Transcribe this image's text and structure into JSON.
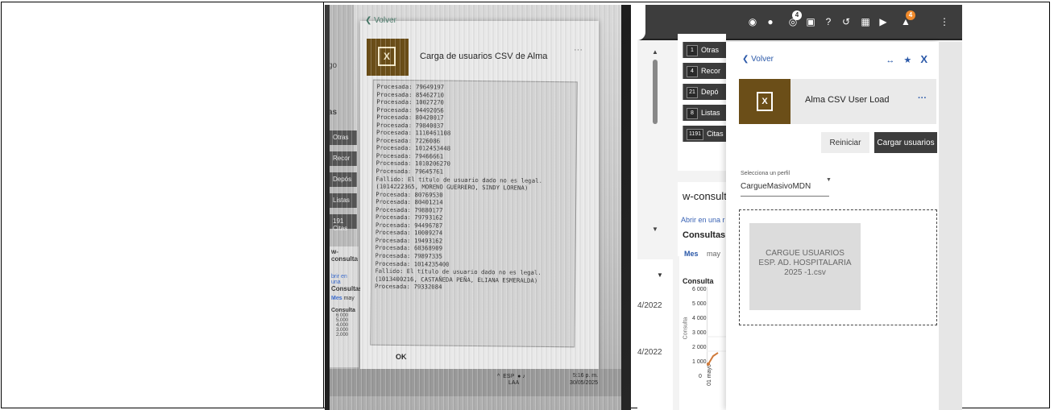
{
  "photo": {
    "back_label": "Volver",
    "dialog_title": "Carga de usuarios CSV de Alma",
    "dialog_menu": "···",
    "tile_glyph": "X",
    "left_fragment_1": "go",
    "left_fragment_2": "as",
    "left_chips": [
      "Otras",
      "Recor",
      "Depós",
      "Listas",
      "191 Citas"
    ],
    "log_lines": [
      "Procesada: 79649197",
      "Procesada: 85462710",
      "Procesada: 10027270",
      "Procesada: 94492056",
      "Procesada: 80420017",
      "Procesada: 79840037",
      "Procesada: 1110461108",
      "Procesada: 7226086",
      "Procesada: 1012453448",
      "Procesada: 79466661",
      "Procesada: 1010206270",
      "Procesada: 79645761",
      "Fallido: El título de usuario dado no es legal. (1014222365, MORENO GUERRERO, SINDY LORENA)",
      "Procesada: 80769530",
      "Procesada: 80401214",
      "Procesada: 79880177",
      "Procesada: 79793162",
      "Procesada: 94496787",
      "Procesada: 10009274",
      "Procesada: 19493162",
      "Procesada: 60368909",
      "Procesada: 79897335",
      "Procesada: 1014235400",
      "Fallido: El título de usuario dado no es legal. (1013400216, CASTAÑEDA PEÑA, ELIANA ESMERALDA)",
      "Procesada: 79332084"
    ],
    "ok_label": "OK",
    "mini_title": "w-consulta",
    "mini_link": "brir en una",
    "mini_sub": "Consultas",
    "mini_mes": "Mes",
    "mini_may": "may",
    "mini_consulta": "Consulta",
    "mini_ticks": [
      "6 000",
      "5.000",
      "4.000",
      "3.000",
      "2.000"
    ],
    "tray_lang": "ESP",
    "tray_lang2": "LAA",
    "clock_time": "5:16 p. m.",
    "clock_date": "30/05/2025"
  },
  "topbar": {
    "icons": [
      "location-icon",
      "user-icon",
      "scan-icon",
      "clipboard-icon",
      "help-icon",
      "history-icon",
      "grid-icon",
      "feather-icon",
      "notifications-icon",
      "more-icon"
    ],
    "badge_scan": "4",
    "badge_notifications": "4"
  },
  "list": {
    "items": [
      {
        "count": "1",
        "label": "Otras"
      },
      {
        "count": "4",
        "label": "Recor"
      },
      {
        "count": "21",
        "label": "Depó"
      },
      {
        "count": "8",
        "label": "Listas"
      },
      {
        "count": "1191",
        "label": "Citas"
      }
    ]
  },
  "widget": {
    "title": "w-consulta",
    "link": "Abrir en una r",
    "subtitle": "Consultas",
    "tab_mes": "Mes",
    "tab_may": "may",
    "chart_title": "Consulta",
    "ylabel": "Consulta",
    "xlabel": "01 mayo",
    "ticks": [
      "6 000",
      "5 000",
      "4 000",
      "3 000",
      "2 000",
      "1 000",
      "0"
    ]
  },
  "lower": {
    "date_1": "4/2022",
    "date_2": "4/2022"
  },
  "panel": {
    "back_label": "Volver",
    "icon_expand": "↔",
    "icon_pin": "★",
    "icon_close": "X",
    "card_title": "Alma CSV User Load",
    "card_menu": "···",
    "tile_glyph": "X",
    "btn_reset": "Reiniciar",
    "btn_load": "Cargar usuarios",
    "select_label": "Selecciona un perfil",
    "select_value": "CargueMasivoMDN",
    "file_name": "CARGUE USUARIOS ESP. AD. HOSPITALARIA 2025 -1.csv"
  },
  "colors": {
    "topbar": "#3d3d3d",
    "tile": "#6b4e18",
    "accent": "#2a58a8",
    "badge_orange": "#f08a2b"
  }
}
